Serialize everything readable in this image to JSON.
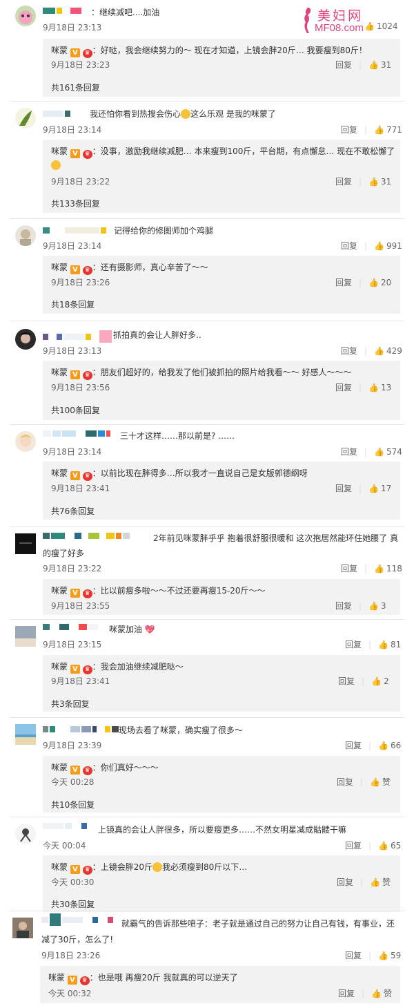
{
  "watermark": {
    "line1": "美妇网",
    "line2": "MF08.com"
  },
  "actions": {
    "reply": "回复",
    "like": "赞"
  },
  "comments": [
    {
      "text": "继续减吧....加油",
      "time": "9月18日 23:13",
      "likes": "1024",
      "reply": {
        "name": "咪蒙",
        "text": "好哒，我会继续努力的～ 现在才知道，上镜会胖20斤… 我要瘦到80斤！",
        "time": "9月18日 23:23",
        "likes": "31"
      },
      "more": "共161条回复"
    },
    {
      "text": "我还怕你看到热搜会伤心",
      "text2": "这么乐观 是我的咪蒙了",
      "time": "9月18日 23:14",
      "likes": "771",
      "reply": {
        "name": "咪蒙",
        "text": "没事，激励我继续减肥… 本来瘦到100斤，平台期，有点懈怠… 现在不敢松懈了",
        "time": "9月18日 23:22",
        "likes": "31"
      },
      "more": "共133条回复"
    },
    {
      "text": "记得给你的修图师加个鸡腿",
      "time": "9月18日 23:14",
      "likes": "991",
      "reply": {
        "name": "咪蒙",
        "text": "还有摄影师，真心辛苦了～～",
        "time": "9月18日 23:26",
        "likes": "20"
      },
      "more": "共18条回复"
    },
    {
      "text": "抓拍真的会让人胖好多..",
      "time": "9月18日 23:13",
      "likes": "429",
      "reply": {
        "name": "咪蒙",
        "text": "朋友们超好的，给我发了他们被抓拍的照片给我看～～ 好感人～～～",
        "time": "9月18日 23:56",
        "likes": "13"
      },
      "more": "共100条回复"
    },
    {
      "text": "三十才这样……那以前是? ……",
      "time": "9月18日 23:14",
      "likes": "574",
      "reply": {
        "name": "咪蒙",
        "text": "以前比现在胖得多…所以我才一直说自己是女版郭德纲呀",
        "time": "9月18日 23:41",
        "likes": "17"
      },
      "more": "共76条回复"
    },
    {
      "text": "2年前见咪蒙胖乎乎 抱着很舒服很暖和 这次抱居然能环住她腰了 真",
      "text2": "的瘦了好多",
      "time": "9月18日 23:22",
      "likes": "118",
      "reply": {
        "name": "咪蒙",
        "text": "比以前瘦多啦～～不过还要再瘦15-20斤～～",
        "time": "9月18日 23:55",
        "likes": "3"
      },
      "more": ""
    },
    {
      "text": "咪蒙加油",
      "time": "9月18日 23:15",
      "likes": "81",
      "reply": {
        "name": "咪蒙",
        "text": "我会加油继续减肥哒～",
        "time": "9月18日 23:41",
        "likes": "2"
      },
      "more": "共3条回复"
    },
    {
      "text": "现场去看了咪蒙，确实瘦了很多～",
      "time": "9月18日 23:39",
      "likes": "66",
      "reply": {
        "name": "咪蒙",
        "text": "你们真好～～～",
        "time": "今天 00:28",
        "likes": "赞"
      },
      "more": "共10条回复"
    },
    {
      "text": "上镜真的会让人胖很多，所以要瘦更多……不然女明星减成骷髅干嘛",
      "time": "今天 00:04",
      "likes": "65",
      "reply": {
        "name": "咪蒙",
        "text": "上镜会胖20斤",
        "text2": "我必须瘦到80斤以下…",
        "time": "今天 00:30",
        "likes": "赞"
      },
      "more": "共30条回复"
    },
    {
      "text": "就霸气的告诉那些喷子：老子就是通过自己的努力让自己有钱，有事业，还",
      "text2": "减了30斤，怎么了!",
      "time": "9月18日 23:26",
      "likes": "59",
      "reply": {
        "name": "咪蒙",
        "text": "也是哦 再瘦20斤 我就真的可以逆天了",
        "time": "今天 00:32",
        "likes": "赞"
      },
      "more": ""
    }
  ]
}
